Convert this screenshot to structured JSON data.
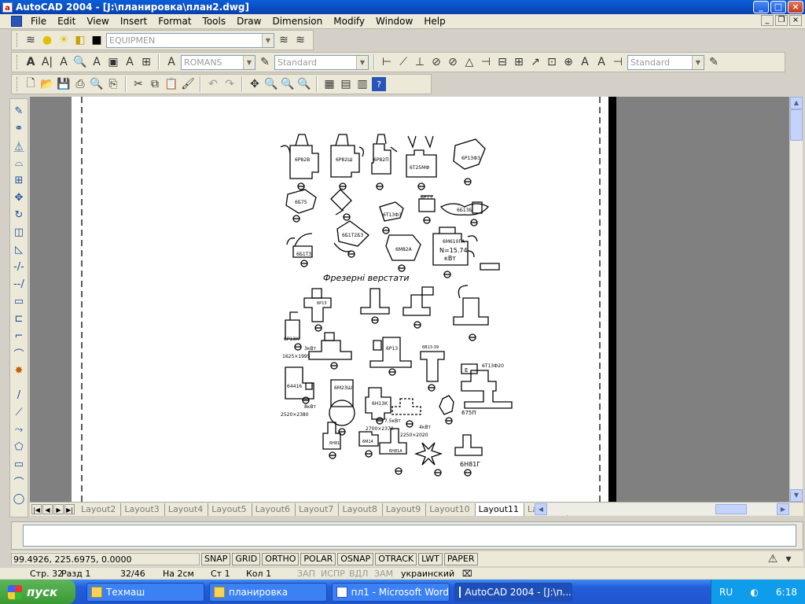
{
  "window": {
    "title": "AutoCAD 2004 - [J:\\планировка\\план2.dwg]"
  },
  "menu": [
    "File",
    "Edit",
    "View",
    "Insert",
    "Format",
    "Tools",
    "Draw",
    "Dimension",
    "Modify",
    "Window",
    "Help"
  ],
  "toolbars": {
    "layer": "EQUIPMEN",
    "text_style": "ROMANS",
    "dim_style": "Standard",
    "table_style": "Standard"
  },
  "drawing": {
    "heading": "Фрезерні верстати",
    "labels": {
      "m1": "6Р82В",
      "m2": "6Р82Ш",
      "m3": "6Р82П",
      "m4": "6Т25МФ",
      "m5": "6Р13Ф3",
      "m6": "6Б75",
      "m7": "6Т13Ф3",
      "m8": "6Р13",
      "m9": "6Б13Б",
      "m10": "6Б1Т3",
      "m11": "6Б1Т2Б3",
      "m12": "6М82А",
      "m13": "6М610ГА",
      "m13_power": "N=15.74",
      "m13_unit": "кВт",
      "m14": "6Р13К",
      "m14_power": "3кВт",
      "m14_dims": "1625×1995",
      "m15": "6Р13",
      "m16": "6В13-39",
      "m17": "6Т13Ф20",
      "m17_mark": "Е",
      "m18": "64416",
      "m18_power": "8кВт",
      "m18_dims": "2520×2380",
      "m19": "6М23Ш",
      "m20": "6Н13К",
      "m20_power": "7.5кВт",
      "m20_dims": "2700×2370",
      "m21": "4кВт",
      "m21_dims": "2250×2020",
      "m22": "675П",
      "m23": "6Н81",
      "m24": "6М14",
      "m25": "6Н81А",
      "m26": "6Н81Г"
    }
  },
  "layout_tabs": [
    "Layout2",
    "Layout3",
    "Layout4",
    "Layout5",
    "Layout6",
    "Layout7",
    "Layout8",
    "Layout9",
    "Layout10",
    "Layout11",
    "Layout1"
  ],
  "active_layout_tab": "Layout11",
  "status": {
    "coords": "99.4926, 225.6975, 0.0000",
    "toggles": [
      "SNAP",
      "GRID",
      "ORTHO",
      "POLAR",
      "OSNAP",
      "OTRACK",
      "LWT",
      "PAPER"
    ]
  },
  "word_info": {
    "page": "Стр. 32",
    "section": "Разд 1",
    "pages": "32/46",
    "at": "На 2см",
    "line": "Ст 1",
    "col": "Кол 1",
    "rec": "ЗАП",
    "trk": "ИСПР",
    "ext": "ВДЛ",
    "ovr": "ЗАМ",
    "lang": "украинский"
  },
  "taskbar": {
    "start": "пуск",
    "tasks": [
      "Техмаш",
      "планировка",
      "пл1 - Microsoft Word",
      "AutoCAD 2004 - [J:\\п..."
    ],
    "lang": "RU",
    "time": "6:18"
  }
}
